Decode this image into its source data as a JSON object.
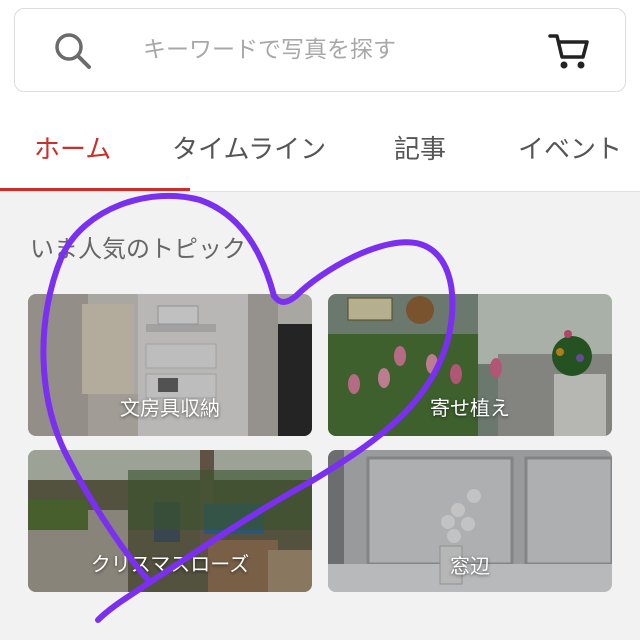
{
  "search": {
    "placeholder": "キーワードで写真を探す",
    "search_icon": "search-icon",
    "cart_icon": "cart-icon"
  },
  "tabs": [
    {
      "label": "ホーム",
      "active": true
    },
    {
      "label": "タイムライン",
      "active": false
    },
    {
      "label": "記事",
      "active": false
    },
    {
      "label": "イベント",
      "active": false
    }
  ],
  "section": {
    "title": "いま人気のトピック"
  },
  "topics": [
    {
      "label": "文房具収納"
    },
    {
      "label": "寄せ植え"
    },
    {
      "label": "クリスマスローズ"
    },
    {
      "label": "窓辺"
    }
  ],
  "colors": {
    "accent": "#c8312b",
    "scribble": "#7b2ff0"
  }
}
